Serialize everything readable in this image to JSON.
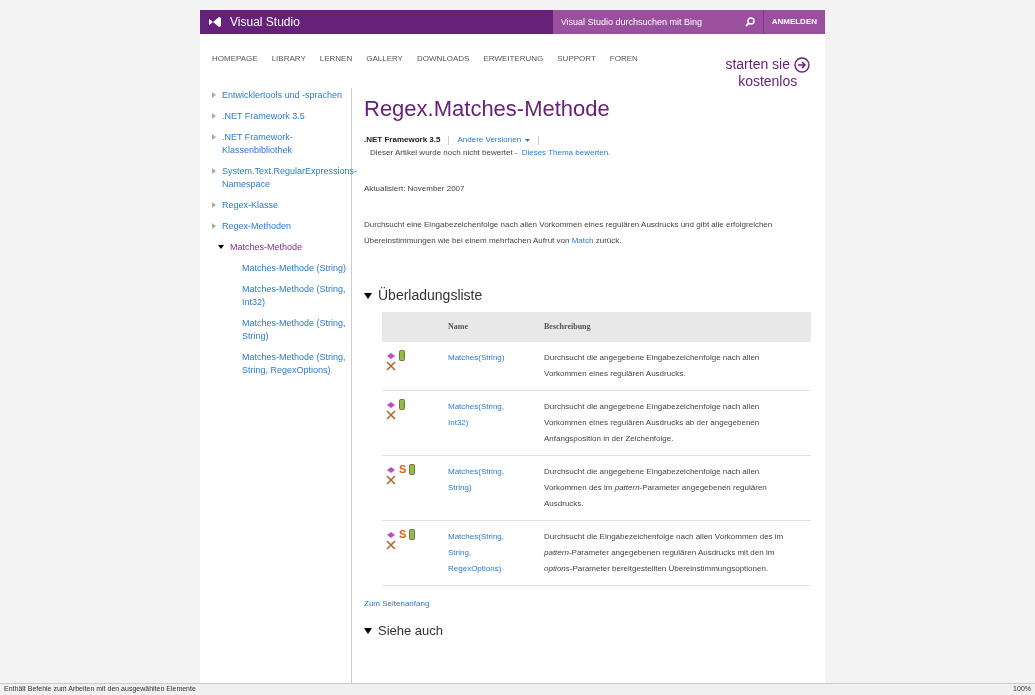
{
  "header": {
    "brand": "Visual Studio",
    "search": {
      "placeholder": "Visual Studio durchsuchen mit Bing"
    },
    "signin": "ANMELDEN"
  },
  "nav": [
    "HOMEPAGE",
    "LIBRARY",
    "LERNEN",
    "GALLERY",
    "DOWNLOADS",
    "ERWEITERUNG",
    "SUPPORT",
    "FOREN"
  ],
  "promo": {
    "line1": "starten sie",
    "line2": "kostenlos"
  },
  "sidebar": {
    "items": [
      {
        "label": "Entwicklertools und -sprachen",
        "selected": false
      },
      {
        "label": ".NET Framework 3.5",
        "selected": false
      },
      {
        "label": ".NET Framework-Klassenbibliothek",
        "selected": false
      },
      {
        "label": "System.Text.RegularExpressions-Namespace",
        "selected": false
      },
      {
        "label": "Regex-Klasse",
        "selected": false
      },
      {
        "label": "Regex-Methoden",
        "selected": false
      },
      {
        "label": "Matches-Methode",
        "selected": true,
        "children": [
          {
            "label": "Matches-Methode (String)",
            "selected": false
          },
          {
            "label": "Matches-Methode (String, Int32)",
            "selected": false
          },
          {
            "label": "Matches-Methode (String, String)",
            "selected": false
          },
          {
            "label": "Matches-Methode (String, String, RegexOptions)",
            "selected": false
          }
        ]
      }
    ]
  },
  "article": {
    "title": "Regex.Matches-Methode",
    "version": ".NET Framework 3.5",
    "other_versions": "Andere Versionen",
    "rating": "Dieser Artikel wurde noch nicht bewertet -",
    "rate_link": "Dieses Thema bewerten.",
    "updated": "Aktualisiert: November 2007",
    "summary": "Durchsucht eine Eingabezeichenfolge nach allen Vorkommen eines regulären Ausdrucks und gibt alle erfolgreichen Übereinstimmungen wie bei einem mehrfachen Aufruf von",
    "summary_link": "Match",
    "summary_end": "zurück.",
    "overloads": {
      "heading": "Überladungsliste",
      "columns": [
        "Name",
        "Beschreibung"
      ],
      "rows": [
        {
          "icons": [
            {
              "kind": "method"
            },
            {
              "kind": "mobile"
            },
            {
              "kind": "xna"
            }
          ],
          "name": "Matches(String)",
          "description": "Durchsucht die angegebene Eingabezeichenfolge nach allen Vorkommen eines regulären Ausdrucks."
        },
        {
          "icons": [
            {
              "kind": "method"
            },
            {
              "kind": "mobile"
            },
            {
              "kind": "xna"
            }
          ],
          "name": "Matches(String, Int32)",
          "description": "Durchsucht die angegebene Eingabezeichenfolge nach allen Vorkommen eines regulären Ausdrucks ab der angegebenen Anfangsposition in der Zeichenfolge."
        },
        {
          "icons": [
            {
              "kind": "method"
            },
            {
              "kind": "static",
              "label": "S"
            },
            {
              "kind": "mobile"
            },
            {
              "kind": "xna"
            }
          ],
          "name": "Matches(String, String)",
          "description": "Durchsucht die angegebene Eingabezeichenfolge nach allen Vorkommen des im *pattern*-Parameter angegebenen regulären Ausdrucks."
        },
        {
          "icons": [
            {
              "kind": "method"
            },
            {
              "kind": "static",
              "label": "S"
            },
            {
              "kind": "mobile"
            },
            {
              "kind": "xna"
            }
          ],
          "name": "Matches(String, String, RegexOptions)",
          "description": "Durchsucht die Eingabezeichenfolge nach allen Vorkommen des im *pattern*-Parameter angegebenen regulären Ausdrucks mit den im *options*-Parameter bereitgestellten Übereinstimmungsoptionen."
        }
      ]
    },
    "back_to_top": "Zum Seitenanfang",
    "see_also": "Siehe auch"
  },
  "status_bar": {
    "text": "Enthält Befehle zum Arbeiten mit den ausgewählten Elemente",
    "zoom": "100%"
  }
}
